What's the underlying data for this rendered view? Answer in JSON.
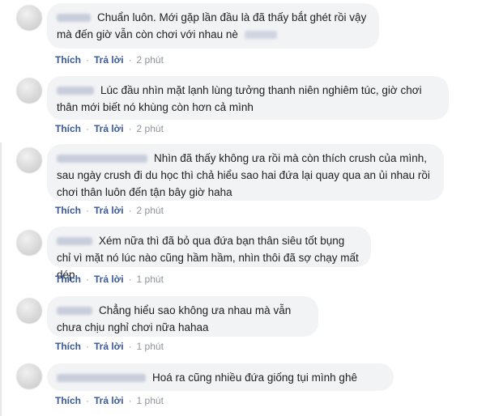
{
  "actions": {
    "like": "Thích",
    "reply": "Trả lời",
    "separator": "·"
  },
  "comments": [
    {
      "text": "Chuẩn luôn. Mới gặp lần đầu là đã thấy bắt ghét rồi vậy mà đến giờ vẫn còn chơi với nhau nè",
      "time": "2 phút"
    },
    {
      "text": "Lúc đầu nhìn mặt lạnh lùng tưởng thanh niên nghiêm túc, giờ chơi thân mới biết nó khùng còn hơn cả mình",
      "time": "2 phút"
    },
    {
      "text": "Nhìn đã thấy không ưa rồi mà còn thích crush của mình, sau ngày crush đi du học thì chả hiểu sao hai đứa lại quay qua an ủi nhau rồi chơi thân luôn đến tận bây giờ haha",
      "time": "2 phút"
    },
    {
      "text": "Xém nữa thì đã bỏ qua đứa bạn thân siêu tốt bụng chỉ vì mặt nó lúc nào cũng hầm hầm, nhìn thôi đã sợ chạy mất dép",
      "time": "1 phút"
    },
    {
      "text": "Chẳng hiểu sao không ưa nhau mà vẫn chưa chịu nghỉ chơi nữa hahaa",
      "time": "1 phút"
    },
    {
      "text": "Hoá ra cũng nhiều đứa giống tụi mình ghê",
      "time": "1 phút"
    }
  ]
}
